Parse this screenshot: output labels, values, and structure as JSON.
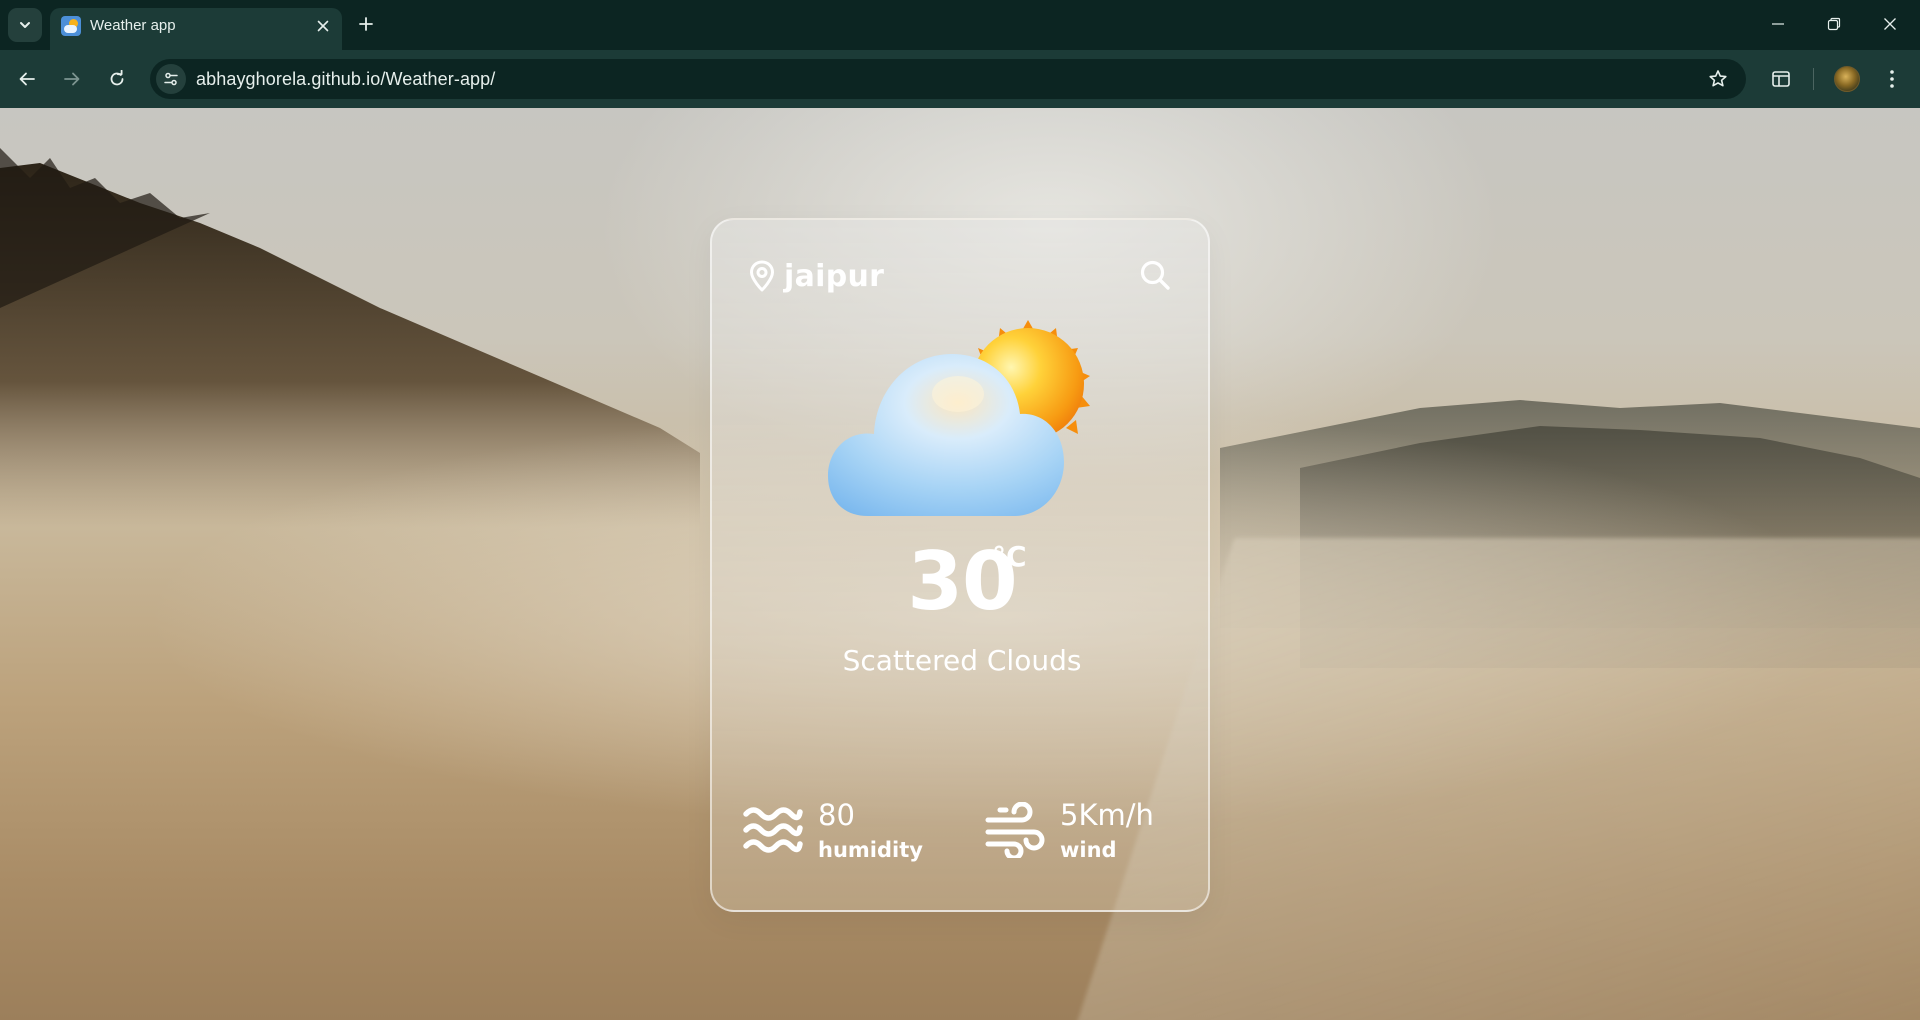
{
  "browser": {
    "tab_title": "Weather app",
    "url": "abhayghorela.github.io/Weather-app/"
  },
  "weather": {
    "city": "jaipur",
    "temperature": "30",
    "temperature_unit": "°C",
    "condition": "Scattered Clouds",
    "humidity_value": "80",
    "humidity_label": "humidity",
    "wind_value": "5Km/h",
    "wind_label": "wind"
  },
  "icons": {
    "tab_search": "chevron-down-icon",
    "favicon": "weather-favicon",
    "tab_close": "close-icon",
    "new_tab": "plus-icon",
    "minimize": "minimize-icon",
    "restore": "restore-icon",
    "close_window": "close-icon",
    "back": "arrow-left-icon",
    "forward": "arrow-right-icon",
    "reload": "reload-icon",
    "site_info": "tune-icon",
    "bookmark": "star-icon",
    "side_panel": "side-panel-icon",
    "menu": "kebab-menu-icon",
    "location": "map-pin-icon",
    "search": "search-icon",
    "weather": "sun-behind-cloud-icon",
    "humidity": "waves-icon",
    "wind": "wind-icon"
  },
  "colors": {
    "chrome_dark": "#0c2522",
    "chrome_toolbar": "#1c3b37",
    "card_text": "#ffffff",
    "sun": "#f7b21c",
    "cloud": "#8cc6f3"
  }
}
